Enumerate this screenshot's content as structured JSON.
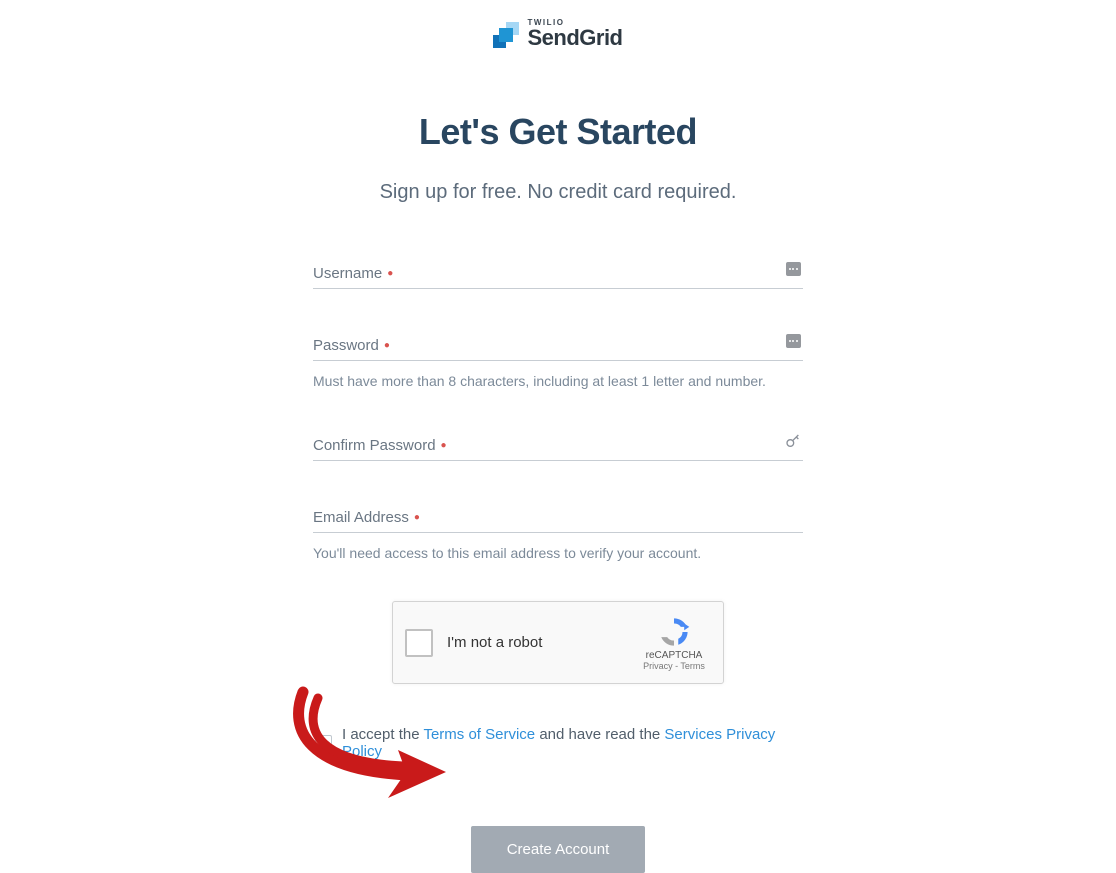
{
  "logo": {
    "tagline": "TWILIO",
    "name": "SendGrid"
  },
  "heading": "Let's Get Started",
  "subheading": "Sign up for free. No credit card required.",
  "fields": {
    "username": {
      "label": "Username"
    },
    "password": {
      "label": "Password",
      "hint": "Must have more than 8 characters, including at least 1 letter and number."
    },
    "confirm_password": {
      "label": "Confirm Password"
    },
    "email": {
      "label": "Email Address",
      "hint": "You'll need access to this email address to verify your account."
    }
  },
  "recaptcha": {
    "label": "I'm not a robot",
    "brand": "reCAPTCHA",
    "links": "Privacy - Terms"
  },
  "terms": {
    "prefix": "I accept the ",
    "tos": "Terms of Service",
    "middle": " and have read the ",
    "privacy": "Services Privacy Policy"
  },
  "submit_label": "Create Account"
}
